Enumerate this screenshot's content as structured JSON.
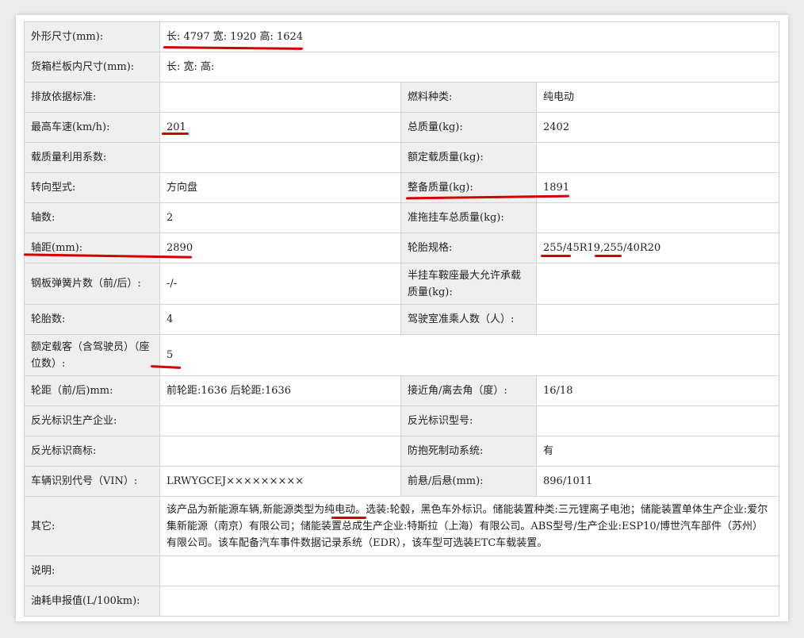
{
  "rows": [
    {
      "l1": "外形尺寸(mm):",
      "v1": "长: 4797 宽: 1920 高: 1624"
    },
    {
      "l1": "货箱栏板内尺寸(mm):",
      "v1": "长:   宽:   高:"
    },
    {
      "l1": "排放依据标准:",
      "v1": "",
      "l2": "燃料种类:",
      "v2": "纯电动"
    },
    {
      "l1": "最高车速(km/h):",
      "v1": "201",
      "l2": "总质量(kg):",
      "v2": "2402"
    },
    {
      "l1": "载质量利用系数:",
      "v1": "",
      "l2": "额定载质量(kg):",
      "v2": ""
    },
    {
      "l1": "转向型式:",
      "v1": "方向盘",
      "l2": "整备质量(kg):",
      "v2": "1891"
    },
    {
      "l1": "轴数:",
      "v1": "2",
      "l2": "准拖挂车总质量(kg):",
      "v2": ""
    },
    {
      "l1": "轴距(mm):",
      "v1": "2890",
      "l2": "轮胎规格:",
      "v2": "255/45R19,255/40R20"
    },
    {
      "l1": "钢板弹簧片数（前/后）:",
      "v1": "-/-",
      "l2": "半挂车鞍座最大允许承载质量(kg):",
      "v2": ""
    },
    {
      "l1": "轮胎数:",
      "v1": "4",
      "l2": "驾驶室准乘人数（人）:",
      "v2": ""
    },
    {
      "l1": "额定载客（含驾驶员）（座位数）:",
      "v1": "5"
    },
    {
      "l1": "轮距（前/后)mm:",
      "v1": "前轮距:1636 后轮距:1636",
      "l2": "接近角/离去角（度）:",
      "v2": "16/18"
    },
    {
      "l1": "反光标识生产企业:",
      "v1": "",
      "l2": "反光标识型号:",
      "v2": ""
    },
    {
      "l1": "反光标识商标:",
      "v1": "",
      "l2": "防抱死制动系统:",
      "v2": "有"
    },
    {
      "l1": "车辆识别代号（VIN）:",
      "v1": "LRWYGCEJ×××××××××",
      "l2": "前悬/后悬(mm):",
      "v2": "896/1011"
    },
    {
      "l1": "其它:",
      "v1": "该产品为新能源车辆,新能源类型为纯电动。选装:轮毂，黑色车外标识。储能装置种类:三元锂离子电池；储能装置单体生产企业:爱尔集新能源（南京）有限公司；储能装置总成生产企业:特斯拉（上海）有限公司。ABS型号/生产企业:ESP10/博世汽车部件（苏州）有限公司。该车配备汽车事件数据记录系统（EDR），该车型可选装ETC车载装置。"
    },
    {
      "l1": "说明:",
      "v1": ""
    },
    {
      "l1": "油耗申报值(L/100km):",
      "v1": ""
    }
  ],
  "annotation_color": "#d40000"
}
